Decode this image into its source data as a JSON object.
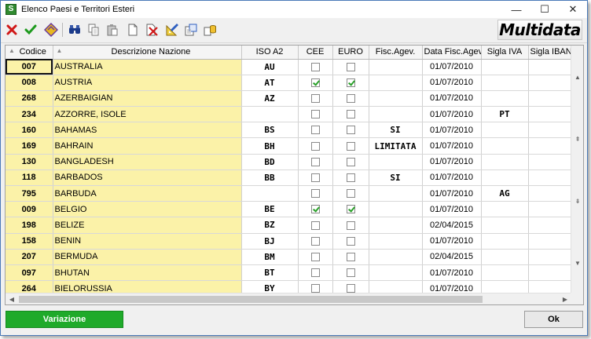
{
  "window": {
    "title": "Elenco Paesi e Territori Esteri",
    "app_icon_glyph": "S",
    "controls": {
      "minimize": "—",
      "maximize": "☐",
      "close": "✕"
    }
  },
  "toolbar": {
    "logo_text": "Multidata",
    "buttons": [
      {
        "name": "delete-button",
        "icon": "red-x-icon"
      },
      {
        "name": "confirm-button",
        "icon": "green-check-icon"
      },
      {
        "name": "filter-button",
        "icon": "diamond-icon"
      },
      {
        "name": "search-button",
        "icon": "binoculars-icon"
      },
      {
        "name": "copy-button",
        "icon": "copy-icon"
      },
      {
        "name": "paste-button",
        "icon": "paste-icon"
      },
      {
        "name": "new-button",
        "icon": "new-document-icon"
      },
      {
        "name": "remove-button",
        "icon": "delete-document-icon"
      },
      {
        "name": "edit-button",
        "icon": "ruler-pencil-icon"
      },
      {
        "name": "export-button",
        "icon": "export-icon"
      },
      {
        "name": "database-button",
        "icon": "database-icon"
      }
    ]
  },
  "table": {
    "headers": {
      "codice": "Codice",
      "descrizione": "Descrizione Nazione",
      "iso": "ISO A2",
      "cee": "CEE",
      "euro": "EURO",
      "fisc": "Fisc.Agev.",
      "data": "Data Fisc.Agev.",
      "iva": "Sigla IVA",
      "iban": "Sigla IBAN"
    },
    "rows": [
      {
        "codice": "007",
        "descrizione": "AUSTRALIA",
        "iso": "AU",
        "cee": false,
        "euro": false,
        "fisc": "",
        "data": "01/07/2010",
        "iva": "",
        "iban": ""
      },
      {
        "codice": "008",
        "descrizione": "AUSTRIA",
        "iso": "AT",
        "cee": true,
        "euro": true,
        "fisc": "",
        "data": "01/07/2010",
        "iva": "",
        "iban": ""
      },
      {
        "codice": "268",
        "descrizione": "AZERBAIGIAN",
        "iso": "AZ",
        "cee": false,
        "euro": false,
        "fisc": "",
        "data": "01/07/2010",
        "iva": "",
        "iban": ""
      },
      {
        "codice": "234",
        "descrizione": "AZZORRE, ISOLE",
        "iso": "",
        "cee": false,
        "euro": false,
        "fisc": "",
        "data": "01/07/2010",
        "iva": "PT",
        "iban": ""
      },
      {
        "codice": "160",
        "descrizione": "BAHAMAS",
        "iso": "BS",
        "cee": false,
        "euro": false,
        "fisc": "SI",
        "data": "01/07/2010",
        "iva": "",
        "iban": ""
      },
      {
        "codice": "169",
        "descrizione": "BAHRAIN",
        "iso": "BH",
        "cee": false,
        "euro": false,
        "fisc": "LIMITATA",
        "data": "01/07/2010",
        "iva": "",
        "iban": ""
      },
      {
        "codice": "130",
        "descrizione": "BANGLADESH",
        "iso": "BD",
        "cee": false,
        "euro": false,
        "fisc": "",
        "data": "01/07/2010",
        "iva": "",
        "iban": ""
      },
      {
        "codice": "118",
        "descrizione": "BARBADOS",
        "iso": "BB",
        "cee": false,
        "euro": false,
        "fisc": "SI",
        "data": "01/07/2010",
        "iva": "",
        "iban": ""
      },
      {
        "codice": "795",
        "descrizione": "BARBUDA",
        "iso": "",
        "cee": false,
        "euro": false,
        "fisc": "",
        "data": "01/07/2010",
        "iva": "AG",
        "iban": ""
      },
      {
        "codice": "009",
        "descrizione": "BELGIO",
        "iso": "BE",
        "cee": true,
        "euro": true,
        "fisc": "",
        "data": "01/07/2010",
        "iva": "",
        "iban": ""
      },
      {
        "codice": "198",
        "descrizione": "BELIZE",
        "iso": "BZ",
        "cee": false,
        "euro": false,
        "fisc": "",
        "data": "02/04/2015",
        "iva": "",
        "iban": ""
      },
      {
        "codice": "158",
        "descrizione": "BENIN",
        "iso": "BJ",
        "cee": false,
        "euro": false,
        "fisc": "",
        "data": "01/07/2010",
        "iva": "",
        "iban": ""
      },
      {
        "codice": "207",
        "descrizione": "BERMUDA",
        "iso": "BM",
        "cee": false,
        "euro": false,
        "fisc": "",
        "data": "02/04/2015",
        "iva": "",
        "iban": ""
      },
      {
        "codice": "097",
        "descrizione": "BHUTAN",
        "iso": "BT",
        "cee": false,
        "euro": false,
        "fisc": "",
        "data": "01/07/2010",
        "iva": "",
        "iban": ""
      },
      {
        "codice": "264",
        "descrizione": "BIELORUSSIA",
        "iso": "BY",
        "cee": false,
        "euro": false,
        "fisc": "",
        "data": "01/07/2010",
        "iva": "",
        "iban": ""
      }
    ]
  },
  "buttons": {
    "variazione": "Variazione",
    "ok": "Ok"
  }
}
